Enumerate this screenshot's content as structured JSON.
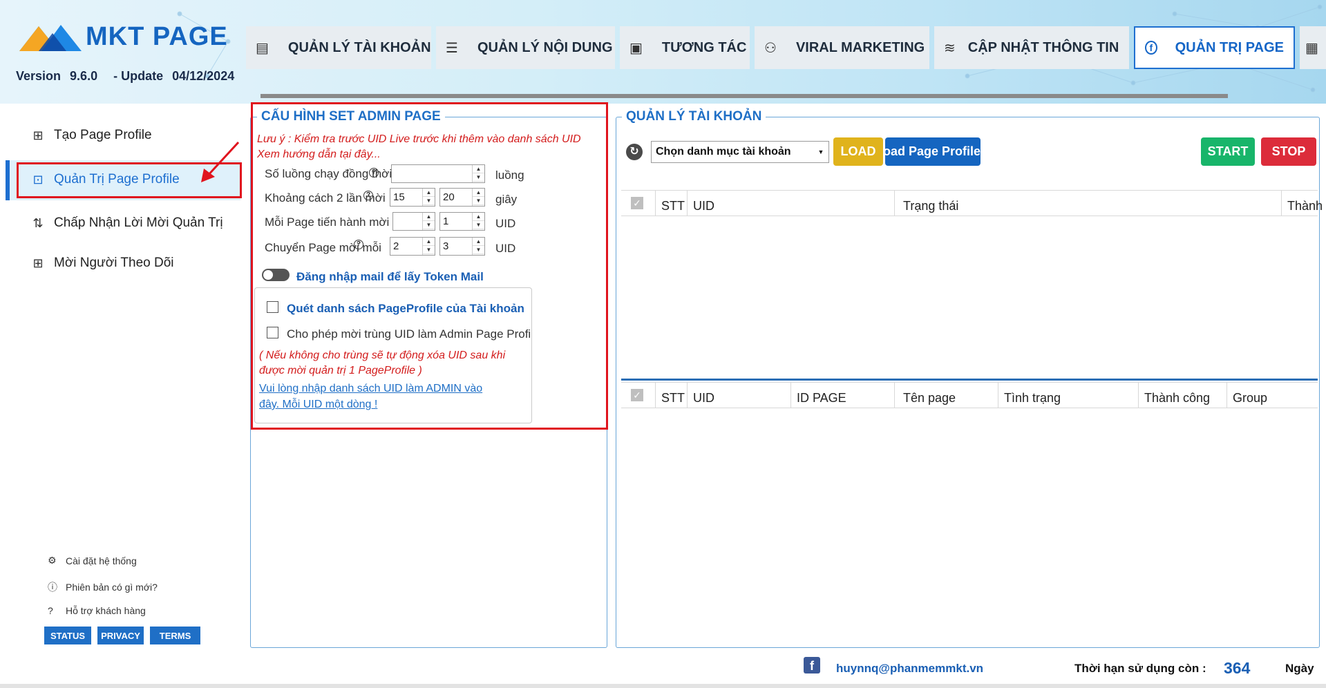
{
  "app": {
    "logo_text": "MKT PAGE",
    "version_label": "Version",
    "version_number": "9.6.0",
    "update_label": "- Update",
    "update_date": "04/12/2024"
  },
  "tabs": [
    {
      "label": "QUẢN LÝ TÀI KHOẢN",
      "icon": "table-icon"
    },
    {
      "label": "QUẢN LÝ NỘI DUNG",
      "icon": "list-icon"
    },
    {
      "label": "TƯƠNG TÁC",
      "icon": "document-icon"
    },
    {
      "label": "VIRAL MARKETING",
      "icon": "group-icon"
    },
    {
      "label": "CẬP NHẬT THÔNG TIN",
      "icon": "signal-icon"
    },
    {
      "label": "QUẢN TRỊ PAGE",
      "icon": "facebook-icon",
      "active": true
    },
    {
      "label": "",
      "icon": "calendar-icon"
    }
  ],
  "sidebar": {
    "items": [
      {
        "label": "Tạo Page Profile",
        "icon": "add-box-icon"
      },
      {
        "label": "Quản Trị Page Profile",
        "icon": "admin-card-icon",
        "active": true
      },
      {
        "label": "Chấp Nhận Lời Mời Quản Trị",
        "icon": "swap-vertical-icon"
      },
      {
        "label": "Mời Người Theo Dõi",
        "icon": "add-box-icon"
      }
    ],
    "footer_links": [
      {
        "label": "Cài đặt hệ thống",
        "icon": "gear-icon"
      },
      {
        "label": "Phiên bản có gì mới?",
        "icon": "info-icon"
      },
      {
        "label": "Hỗ trợ khách hàng",
        "icon": "help-icon"
      }
    ],
    "badges": [
      "STATUS",
      "PRIVACY",
      "TERMS"
    ]
  },
  "config": {
    "title": "CẤU HÌNH SET ADMIN PAGE",
    "note_line1": "Lưu ý : Kiểm tra trước UID Live trước khi thêm vào danh sách UID",
    "note_line2": "Xem hướng dẫn tại đây...",
    "threads_label": "Số luồng chạy đồng thời",
    "threads_value": "",
    "threads_unit": "luồng",
    "delay_label": "Khoảng cách 2 lần mời",
    "delay_min": "15",
    "delay_max": "20",
    "delay_unit": "giây",
    "per_page_label": "Mỗi Page tiến hành mời",
    "per_page_min": "",
    "per_page_max": "1",
    "per_page_unit": "UID",
    "switch_label": "Chuyển Page mời mỗi",
    "switch_min": "2",
    "switch_max": "3",
    "switch_unit": "UID",
    "toggle_label": "Đăng nhập mail để lấy Token Mail",
    "scan_label": "Quét danh sách PageProfile của Tài khoản",
    "allow_dup_label": "Cho phép mời trùng UID làm Admin Page Profile",
    "warn_line1": "( Nếu không cho trùng sẽ tự động xóa UID sau khi",
    "warn_line2": "được mời quản trị 1 PageProfile )",
    "link_line1": "Vui lòng nhập danh sách UID làm ADMIN vào",
    "link_line2": "đây. Mỗi UID một dòng !"
  },
  "accounts": {
    "title": "QUẢN LÝ TÀI KHOẢN",
    "select_value": "Chọn danh mục tài khoản",
    "load_button": "LOAD",
    "load_page_button": "Load Page Profile",
    "start_button": "START",
    "stop_button": "STOP",
    "table1_columns": [
      "STT",
      "UID",
      "Trạng thái",
      "Thành công"
    ],
    "table2_columns": [
      "STT",
      "UID",
      "ID PAGE",
      "Tên page",
      "Tình trạng",
      "Thành công",
      "Group"
    ]
  },
  "footer": {
    "email": "huynnq@phanmemmkt.vn",
    "expiry_label": "Thời hạn sử dụng còn :",
    "days_value": "364",
    "days_unit": "Ngày"
  },
  "colors": {
    "accent": "#1e6fd0",
    "highlight_red": "#e0141e",
    "load": "#e0b31c",
    "load_page": "#1565c0",
    "start": "#18b56a",
    "stop": "#dc2c3a"
  }
}
